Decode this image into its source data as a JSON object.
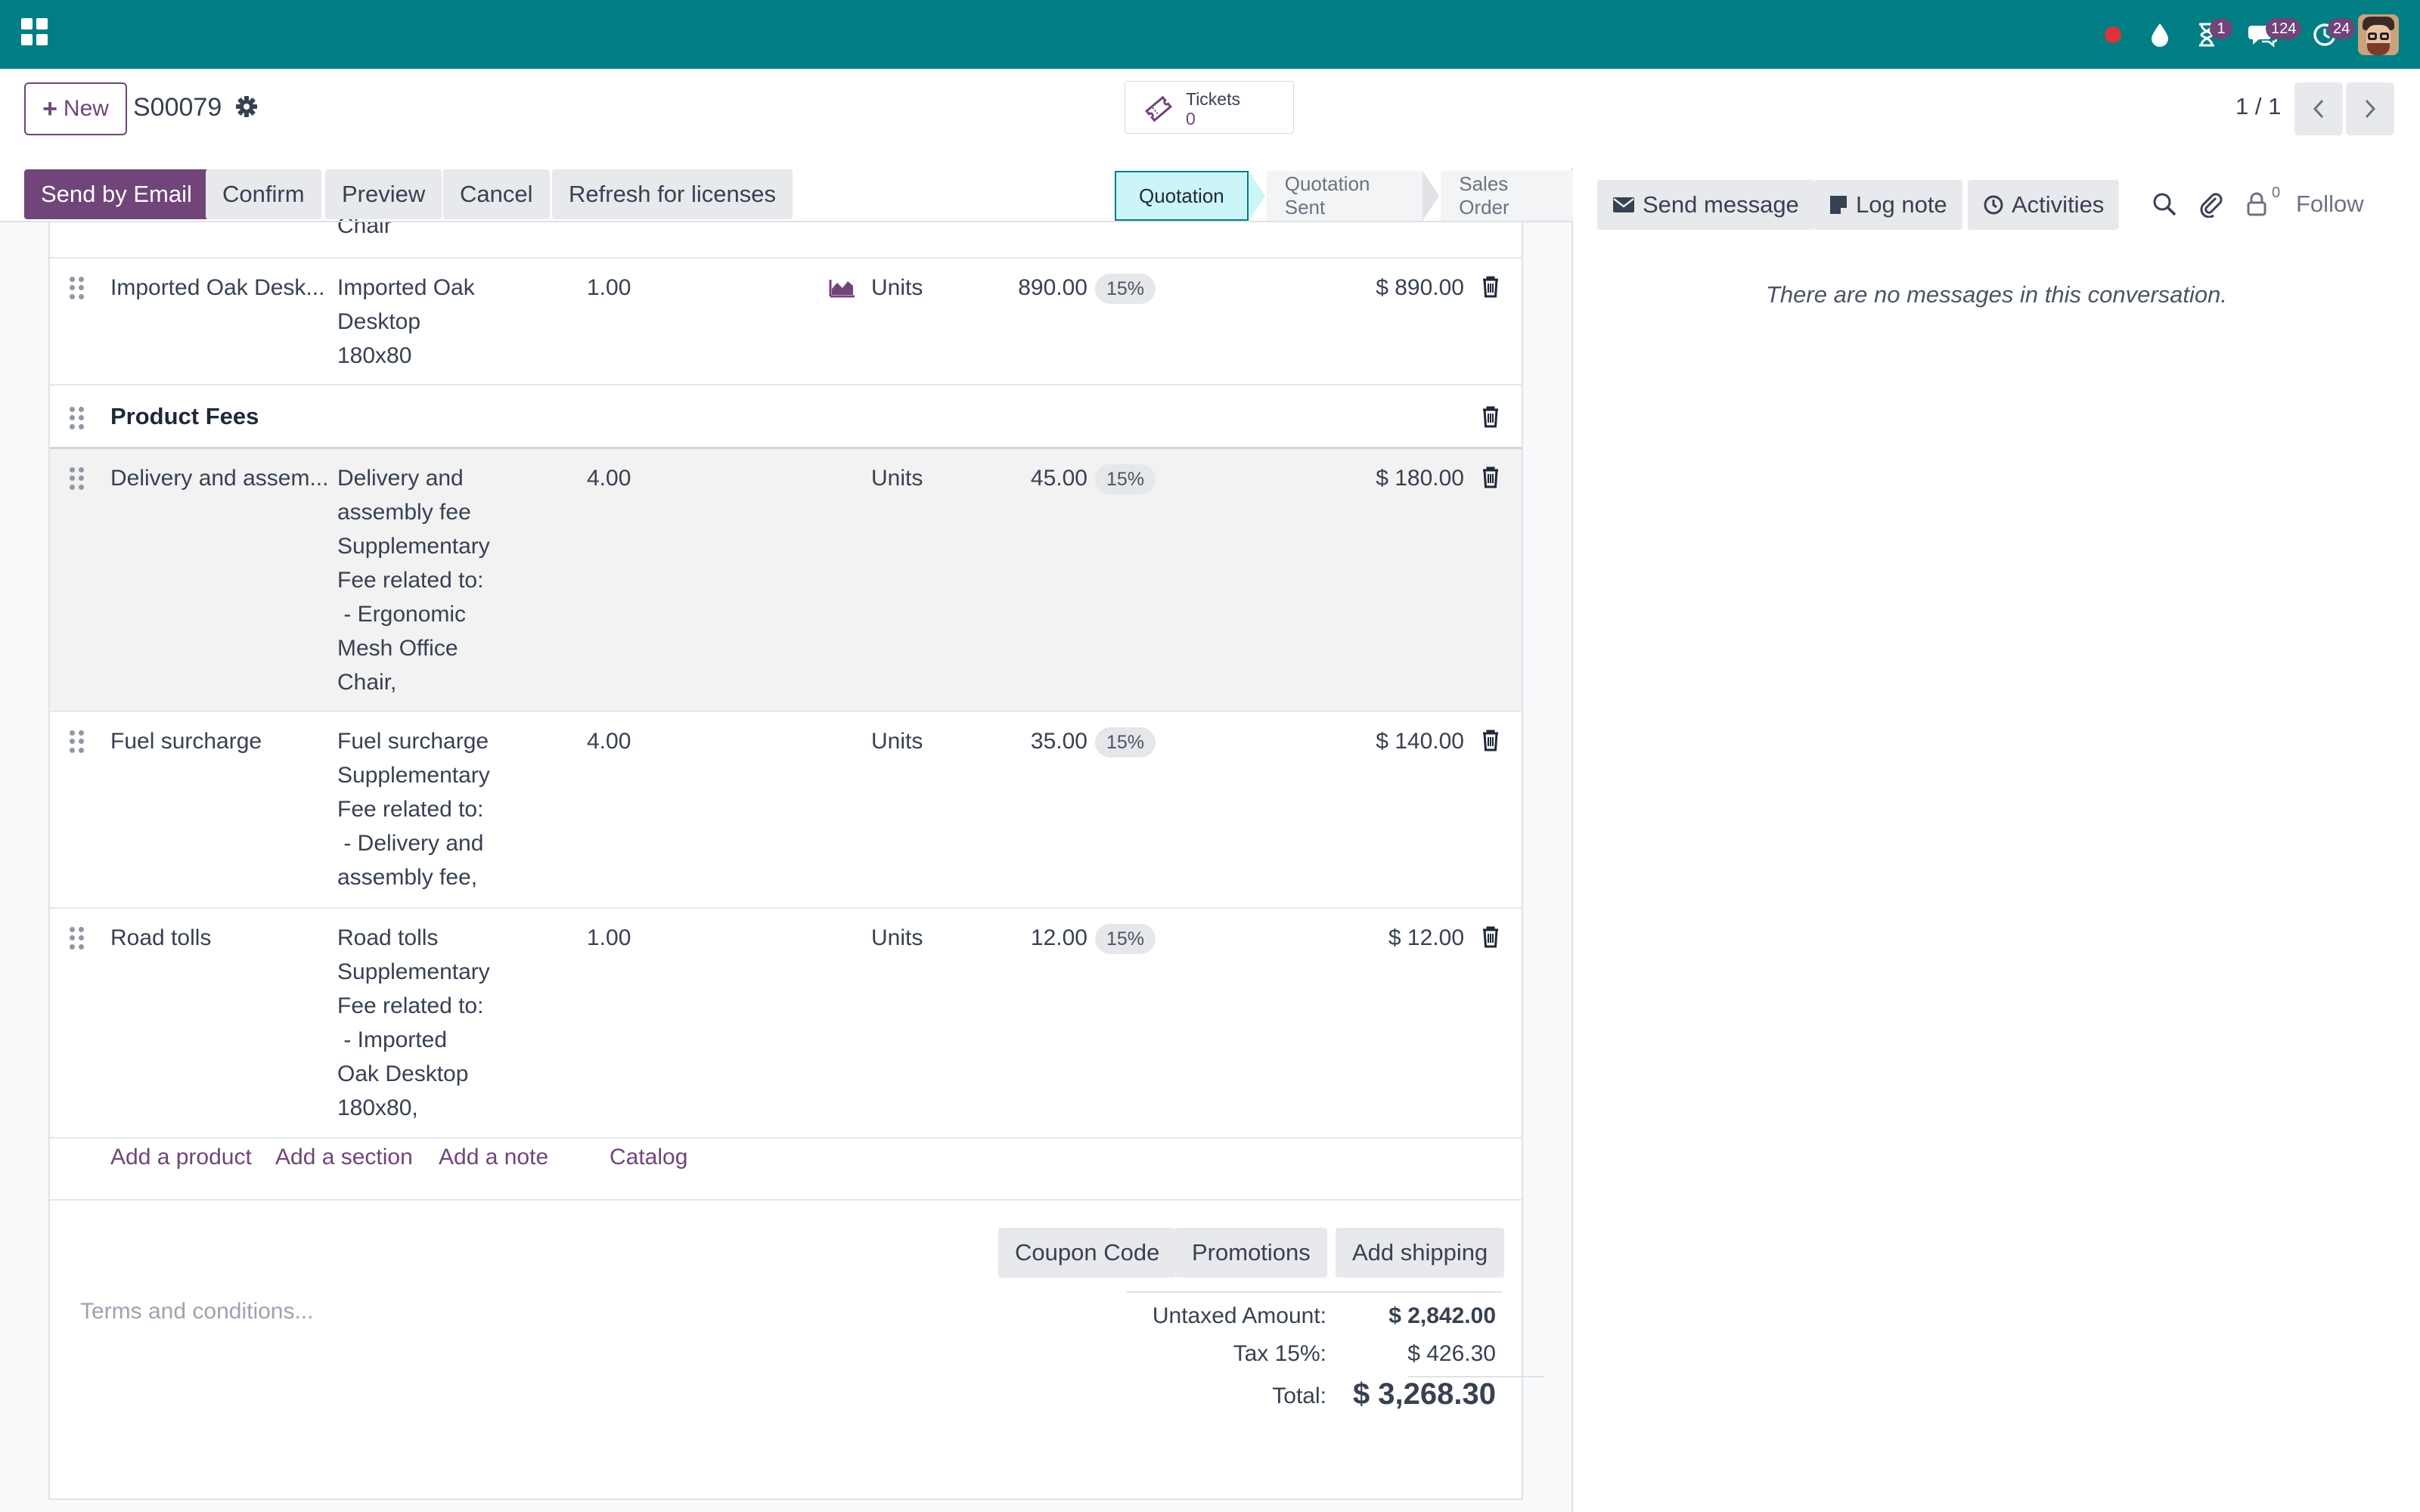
{
  "navbar": {
    "badges": {
      "activity": "1",
      "messages": "124",
      "clock": "24"
    }
  },
  "control_panel": {
    "new_label": "New",
    "record_name": "S00079",
    "tickets_label": "Tickets",
    "tickets_count": "0",
    "pager": "1 / 1"
  },
  "statusbar": {
    "buttons": [
      "Send by Email",
      "Confirm",
      "Preview",
      "Cancel",
      "Refresh for licenses"
    ],
    "stages": [
      "Quotation",
      "Quotation Sent",
      "Sales Order"
    ],
    "active_stage": "Quotation"
  },
  "order_lines": {
    "partial_top_text": "Chair",
    "rows": [
      {
        "product": "Imported Oak Desk...",
        "desc": [
          "Imported Oak",
          "Desktop",
          "180x80"
        ],
        "qty": "1.00",
        "unit": "Units",
        "price": "890.00",
        "tax": "15%",
        "subtotal": "$ 890.00",
        "forecast_icon": "area-chart-icon"
      },
      {
        "section": "Product Fees"
      },
      {
        "product": "Delivery and assem...",
        "desc": [
          "Delivery and",
          "assembly fee",
          "Supplementary",
          "Fee related to:",
          " - Ergonomic",
          "Mesh Office",
          "Chair,"
        ],
        "qty": "4.00",
        "unit": "Units",
        "price": "45.00",
        "tax": "15%",
        "subtotal": "$ 180.00"
      },
      {
        "product": "Fuel surcharge",
        "desc": [
          "Fuel surcharge",
          "Supplementary",
          "Fee related to:",
          " - Delivery and",
          "assembly fee,"
        ],
        "qty": "4.00",
        "unit": "Units",
        "price": "35.00",
        "tax": "15%",
        "subtotal": "$ 140.00"
      },
      {
        "product": "Road tolls",
        "desc": [
          "Road tolls",
          "Supplementary",
          "Fee related to:",
          " - Imported",
          "Oak Desktop",
          "180x80,"
        ],
        "qty": "1.00",
        "unit": "Units",
        "price": "12.00",
        "tax": "15%",
        "subtotal": "$ 12.00"
      }
    ],
    "add_links": [
      "Add a product",
      "Add a section",
      "Add a note",
      "Catalog"
    ]
  },
  "footer": {
    "buttons": [
      "Coupon Code",
      "Promotions",
      "Add shipping"
    ],
    "terms_placeholder": "Terms and conditions...",
    "totals": {
      "untaxed_label": "Untaxed Amount:",
      "untaxed_value": "$ 2,842.00",
      "tax_label": "Tax 15%:",
      "tax_value": "$ 426.30",
      "total_label": "Total:",
      "total_value": "$ 3,268.30"
    }
  },
  "chatter": {
    "send_message": "Send message",
    "log_note": "Log note",
    "activities": "Activities",
    "followers_count": "0",
    "follow": "Follow",
    "empty_text": "There are no messages in this conversation."
  },
  "colors": {
    "navbar": "#017e84",
    "primary": "#71447a",
    "stage_active": "#ccf5f7"
  }
}
